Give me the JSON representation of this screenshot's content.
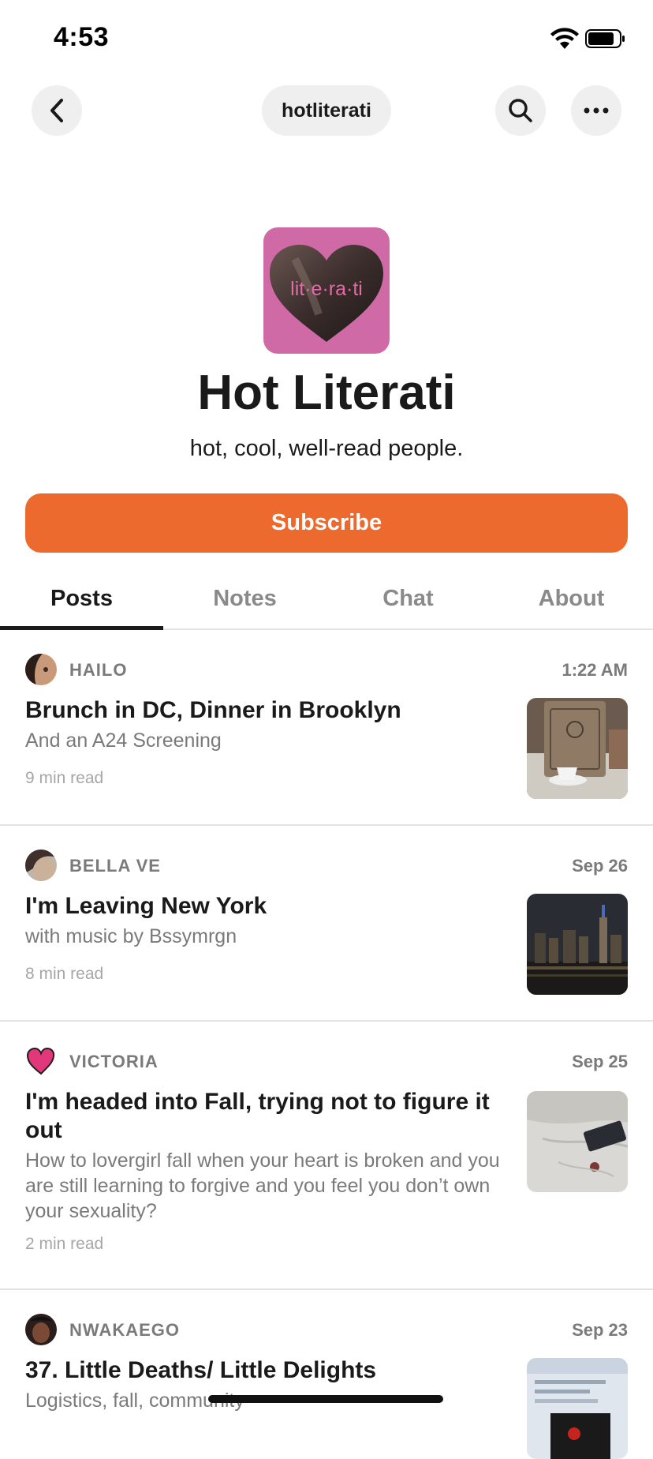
{
  "status": {
    "time": "4:53"
  },
  "nav": {
    "handle": "hotliterati"
  },
  "publication": {
    "logo_text": "lit·e·ra·ti",
    "title": "Hot Literati",
    "tagline": "hot, cool, well-read people.",
    "subscribe_label": "Subscribe"
  },
  "tabs": [
    {
      "label": "Posts"
    },
    {
      "label": "Notes"
    },
    {
      "label": "Chat"
    },
    {
      "label": "About"
    }
  ],
  "posts": [
    {
      "author": "HAILO",
      "date": "1:22 AM",
      "title": "Brunch in DC, Dinner in Brooklyn",
      "subtitle": "And an A24 Screening",
      "read_time": "9 min read"
    },
    {
      "author": "BELLA VE",
      "date": "Sep 26",
      "title": "I'm Leaving New York",
      "subtitle": "with music by Bssymrgn",
      "read_time": "8 min read"
    },
    {
      "author": "VICTORIA",
      "date": "Sep 25",
      "title": "I'm headed into Fall, trying not to figure it out",
      "subtitle": "How to lovergirl fall when your heart is broken and you are still learning to forgive and you feel you don’t own your sexuality?",
      "read_time": "2 min read"
    },
    {
      "author": "NWAKAEGO",
      "date": "Sep 23",
      "title": "37. Little Deaths/ Little Delights",
      "subtitle": "Logistics, fall, community",
      "read_time": ""
    }
  ],
  "colors": {
    "accent": "#ec6a2e",
    "logo_bg": "#cf6aa6"
  }
}
